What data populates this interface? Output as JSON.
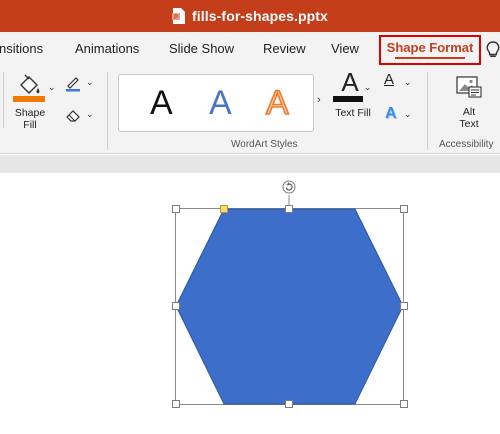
{
  "window": {
    "title": "fills-for-shapes.pptx"
  },
  "tabs": [
    {
      "label": "nsitions"
    },
    {
      "label": "Animations"
    },
    {
      "label": "Slide Show"
    },
    {
      "label": "Review"
    },
    {
      "label": "View"
    }
  ],
  "active_tab": {
    "label": "Shape Format"
  },
  "ribbon": {
    "shape_fill": {
      "label": "Shape\nFill"
    },
    "wordart_styles": {
      "samples": [
        {
          "glyph": "A",
          "style": "black-fill"
        },
        {
          "glyph": "A",
          "style": "blue-fill"
        },
        {
          "glyph": "A",
          "style": "orange-outline"
        }
      ],
      "group_label": "WordArt Styles"
    },
    "text_fill": {
      "label": "Text Fill"
    },
    "text_outline_glyph": "A",
    "text_effects_glyph": "A",
    "alt_text": {
      "label": "Alt\nText"
    },
    "accessibility": {
      "group_label": "Accessibility"
    }
  },
  "colors": {
    "title_bar": "#c43e1c",
    "shape_fill_swatch": "#f07a00",
    "hexagon_fill": "#3d6ec9",
    "text_fill_bar": "#111111",
    "highlight_border": "#e00000"
  },
  "shape": {
    "type": "hexagon",
    "selected": true
  }
}
